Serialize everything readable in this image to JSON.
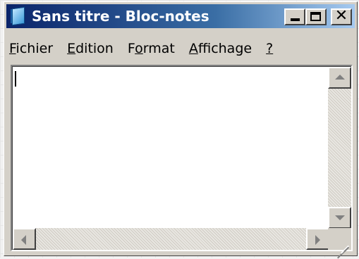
{
  "window": {
    "title": "Sans titre - Bloc-notes",
    "icon": "notepad-icon"
  },
  "title_buttons": {
    "minimize_icon": "minimize-icon",
    "maximize_icon": "maximize-icon",
    "close_icon": "close-icon",
    "close_glyph": "✕"
  },
  "menu": {
    "items": [
      {
        "mnemonic": "F",
        "rest": "ichier"
      },
      {
        "mnemonic": "E",
        "rest": "dition"
      },
      {
        "pre": "F",
        "mnemonic": "o",
        "rest": "rmat"
      },
      {
        "mnemonic": "A",
        "rest": "ffichage"
      },
      {
        "mnemonic": "?",
        "rest": ""
      }
    ]
  },
  "editor": {
    "text": "",
    "caret_visible": true
  },
  "scrollbars": {
    "vertical": true,
    "horizontal": true
  },
  "colors": {
    "title_gradient_start": "#0a246a",
    "title_gradient_end": "#a6caf0",
    "face": "#d4d0c8"
  }
}
